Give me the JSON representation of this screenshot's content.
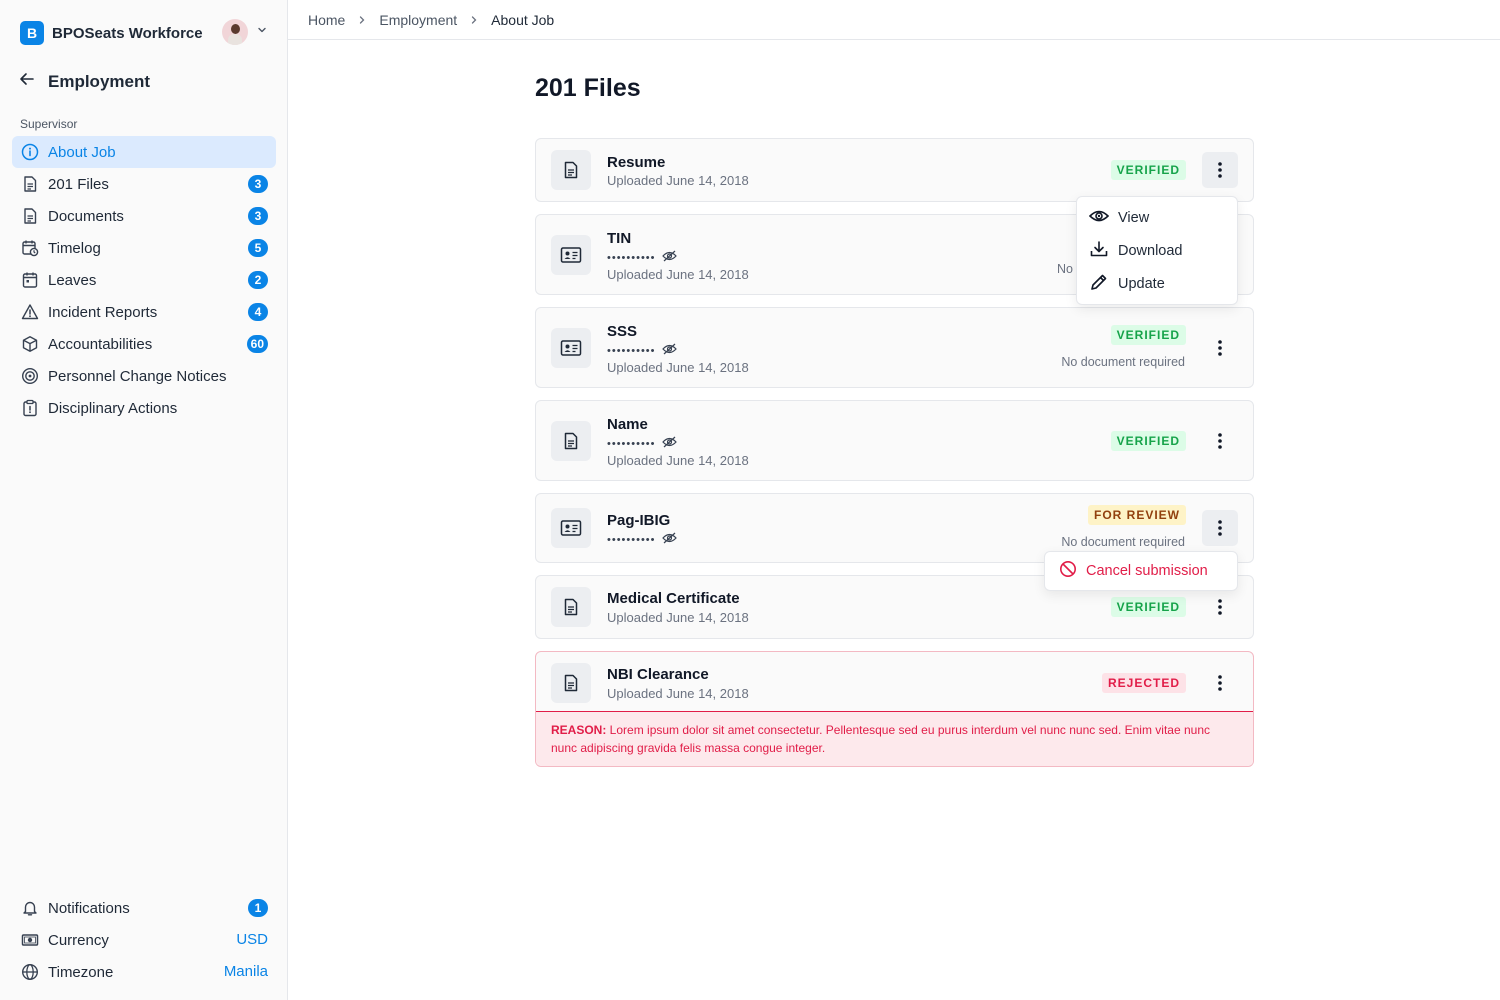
{
  "app": {
    "logo_letter": "B",
    "name": "BPOSeats Workforce"
  },
  "sidebar": {
    "back_title": "Employment",
    "section_label": "Supervisor",
    "items": [
      {
        "label": "About Job",
        "icon": "info-icon",
        "active": true
      },
      {
        "label": "201 Files",
        "icon": "document-icon",
        "badge": "3"
      },
      {
        "label": "Documents",
        "icon": "document-icon",
        "badge": "3"
      },
      {
        "label": "Timelog",
        "icon": "calendar-clock-icon",
        "badge": "5"
      },
      {
        "label": "Leaves",
        "icon": "calendar-icon",
        "badge": "2"
      },
      {
        "label": "Incident Reports",
        "icon": "warning-icon",
        "badge": "4"
      },
      {
        "label": "Accountabilities",
        "icon": "box-icon",
        "badge": "60"
      },
      {
        "label": "Personnel Change Notices",
        "icon": "target-icon"
      },
      {
        "label": "Disciplinary Actions",
        "icon": "clipboard-alert-icon"
      }
    ],
    "bottom": {
      "notifications": {
        "label": "Notifications",
        "badge": "1"
      },
      "currency": {
        "label": "Currency",
        "value": "USD"
      },
      "timezone": {
        "label": "Timezone",
        "value": "Manila"
      }
    }
  },
  "breadcrumb": [
    "Home",
    "Employment",
    "About Job"
  ],
  "page": {
    "title": "201 Files"
  },
  "files": [
    {
      "name": "Resume",
      "date": "Uploaded June 14, 2018",
      "status": "VERIFIED"
    },
    {
      "name": "TIN",
      "masked": "••••••••••",
      "date": "Uploaded June 14, 2018",
      "note": "No"
    },
    {
      "name": "SSS",
      "masked": "••••••••••",
      "date": "Uploaded June 14, 2018",
      "status": "VERIFIED",
      "note": "No document required"
    },
    {
      "name": "Name",
      "masked": "••••••••••",
      "date": "Uploaded June 14, 2018",
      "status": "VERIFIED"
    },
    {
      "name": "Pag-IBIG",
      "masked": "••••••••••",
      "status": "FOR REVIEW",
      "note": "No document required"
    },
    {
      "name": "Medical Certificate",
      "date": "Uploaded June 14, 2018",
      "status": "VERIFIED"
    },
    {
      "name": "NBI Clearance",
      "date": "Uploaded June 14, 2018",
      "status": "REJECTED",
      "reason_label": "REASON:",
      "reason_text": " Lorem ipsum dolor sit amet consectetur. Pellentesque sed eu purus interdum vel nunc nunc sed. Enim vitae nunc nunc adipiscing gravida felis massa congue integer."
    }
  ],
  "actions_menu": {
    "view": "View",
    "download": "Download",
    "update": "Update"
  },
  "review_menu": {
    "cancel": "Cancel submission"
  },
  "colors": {
    "accent": "#0a84e6",
    "verified": "#16a34a",
    "review": "#92400e",
    "rejected": "#e11d48"
  }
}
